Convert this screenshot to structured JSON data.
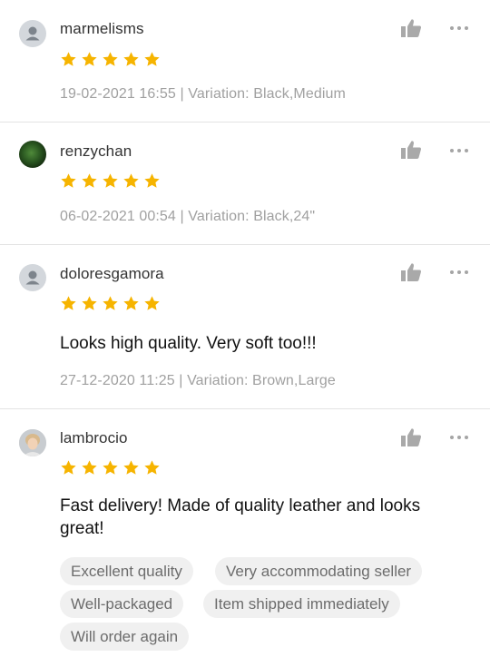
{
  "colors": {
    "star": "#F6B400",
    "like_icon": "#a9a9a9",
    "meta_text": "#a0a0a0",
    "tag_bg": "#f0f0f0"
  },
  "reviews": [
    {
      "username": "marmelisms",
      "avatar": "default-avatar-icon",
      "rating": 5,
      "timestamp": "19-02-2021 16:55",
      "variation": "| Variation: Black,Medium",
      "comment": "",
      "tags": []
    },
    {
      "username": "renzychan",
      "avatar": "profile-photo",
      "rating": 5,
      "timestamp": "06-02-2021 00:54",
      "variation": "| Variation: Black,24\"",
      "comment": "",
      "tags": []
    },
    {
      "username": "doloresgamora",
      "avatar": "default-avatar-icon",
      "rating": 5,
      "timestamp": "27-12-2020 11:25",
      "variation": "| Variation: Brown,Large",
      "comment": "Looks high quality. Very soft too!!!",
      "tags": []
    },
    {
      "username": "lambrocio",
      "avatar": "profile-photo",
      "rating": 5,
      "timestamp": "",
      "variation": "",
      "comment": "Fast delivery! Made of quality leather and looks great!",
      "tags": [
        "Excellent quality",
        "Very accommodating seller",
        "Well-packaged",
        "Item shipped immediately",
        "Will order again"
      ]
    }
  ]
}
